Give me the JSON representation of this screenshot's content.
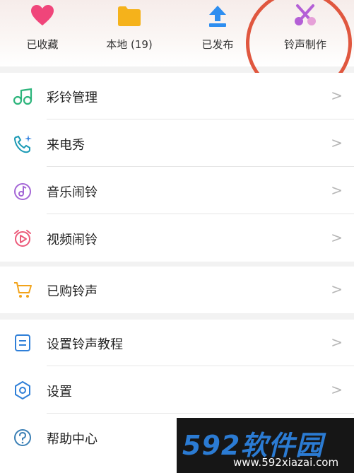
{
  "top_bar": {
    "items": [
      {
        "label": "已收藏",
        "icon": "heart-icon"
      },
      {
        "label": "本地 (19)",
        "icon": "folder-icon"
      },
      {
        "label": "已发布",
        "icon": "upload-icon"
      },
      {
        "label": "铃声制作",
        "icon": "scissors-icon"
      }
    ]
  },
  "menu": {
    "group1": [
      {
        "label": "彩铃管理",
        "icon": "music-note-icon"
      },
      {
        "label": "来电秀",
        "icon": "phone-sparkle-icon"
      },
      {
        "label": "音乐闹铃",
        "icon": "music-alarm-icon"
      },
      {
        "label": "视频闹铃",
        "icon": "video-alarm-icon"
      }
    ],
    "group2": [
      {
        "label": "已购铃声",
        "icon": "cart-icon"
      }
    ],
    "group3": [
      {
        "label": "设置铃声教程",
        "icon": "tutorial-icon"
      },
      {
        "label": "设置",
        "icon": "settings-icon"
      },
      {
        "label": "帮助中心",
        "icon": "help-icon"
      }
    ],
    "chevron": ">"
  },
  "watermark": {
    "brand": "592软件园",
    "url": "www.592xiazai.com"
  },
  "colors": {
    "heart": "#f0457a",
    "folder": "#f5b21b",
    "upload": "#2e8ef0",
    "scissors": "#b45fd6",
    "annotation_ring": "#e0573f"
  }
}
